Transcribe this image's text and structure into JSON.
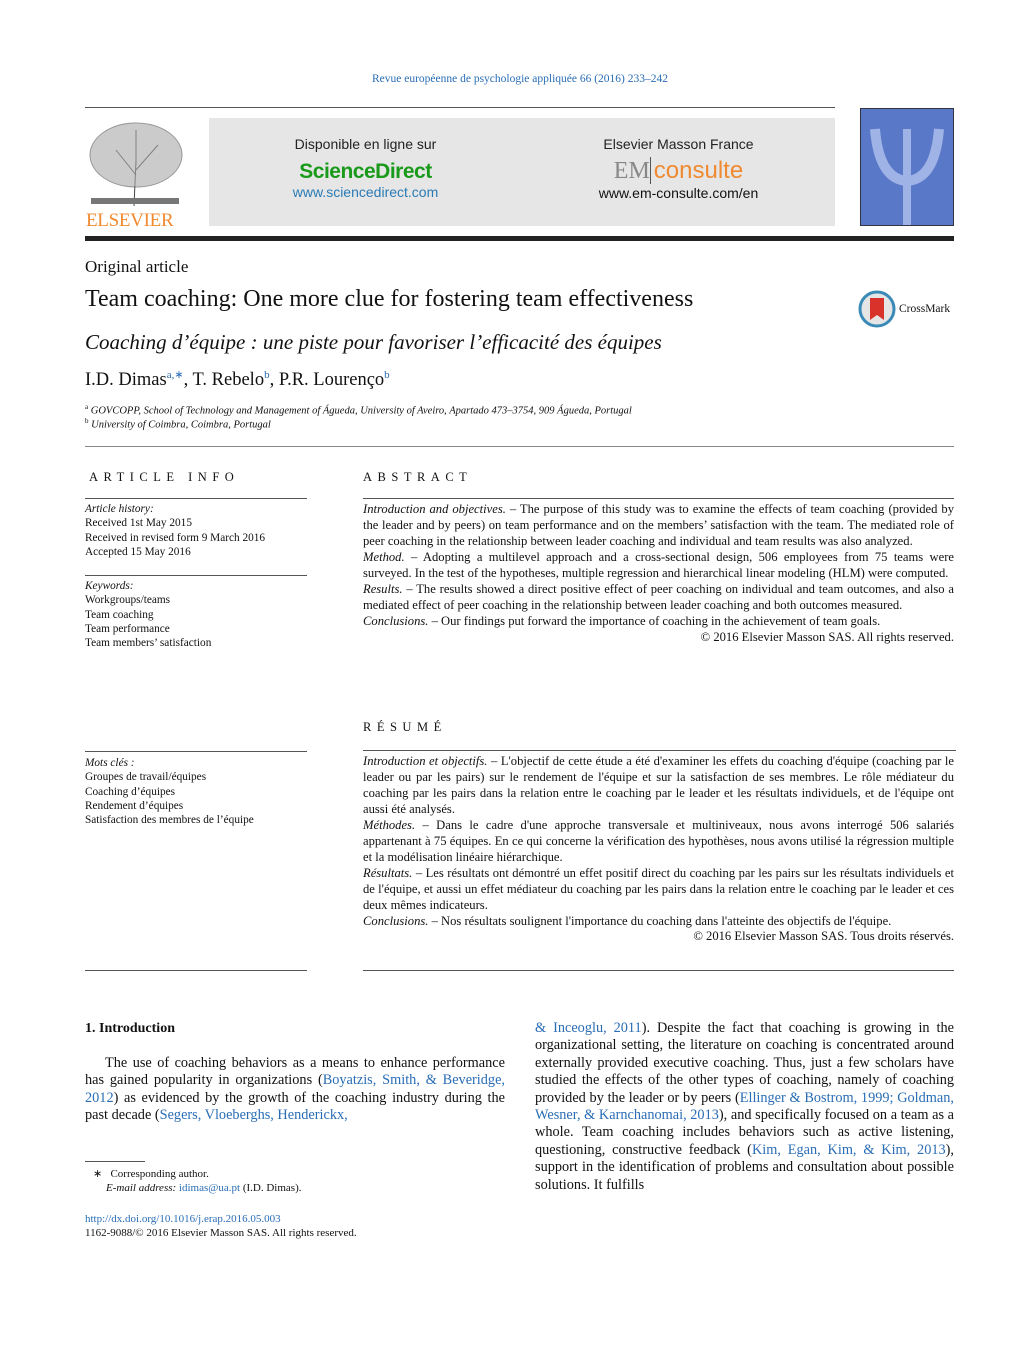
{
  "journal": "Revue européenne de psychologie appliquée 66 (2016) 233–242",
  "banner": {
    "left_title": "Disponible en ligne sur",
    "sciencedirect": "ScienceDirect",
    "sd_url": "www.sciencedirect.com",
    "right_title": "Elsevier Masson France",
    "em": "EM",
    "consulte": "consulte",
    "em_url": "www.em-consulte.com/en"
  },
  "publisher_logo": "ELSEVIER",
  "crossmark": "CrossMark",
  "article_type": "Original article",
  "title": "Team coaching: One more clue for fostering team effectiveness",
  "french_title": "Coaching d’équipe : une piste pour favoriser l’efficacité des équipes",
  "authors": [
    {
      "name": "I.D. Dimas",
      "sup": "a,∗"
    },
    {
      "name": "T. Rebelo",
      "sup": "b"
    },
    {
      "name": "P.R. Lourenço",
      "sup": "b"
    }
  ],
  "affiliations": [
    {
      "sup": "a",
      "text": "GOVCOPP, School of Technology and Management of Águeda, University of Aveiro, Apartado 473–3754, 909 Águeda, Portugal"
    },
    {
      "sup": "b",
      "text": "University of Coimbra, Coimbra, Portugal"
    }
  ],
  "article_info": {
    "heading": "ARTICLE INFO",
    "history_label": "Article history:",
    "history": [
      "Received 1st May 2015",
      "Received in revised form 9 March 2016",
      "Accepted 15 May 2016"
    ],
    "keywords_label": "Keywords:",
    "keywords": [
      "Workgroups/teams",
      "Team coaching",
      "Team performance",
      "Team members’ satisfaction"
    ],
    "mots_label": "Mots clés :",
    "mots": [
      "Groupes de travail/équipes",
      "Coaching d’équipes",
      "Rendement d’équipes",
      "Satisfaction des membres de l’équipe"
    ]
  },
  "abstract": {
    "heading": "ABSTRACT",
    "paragraphs": [
      {
        "label": "Introduction and objectives.",
        "text": " – The purpose of this study was to examine the effects of team coaching (provided by the leader and by peers) on team performance and on the members’ satisfaction with the team. The mediated role of peer coaching in the relationship between leader coaching and individual and team results was also analyzed."
      },
      {
        "label": "Method.",
        "text": " – Adopting a multilevel approach and a cross-sectional design, 506 employees from 75 teams were surveyed. In the test of the hypotheses, multiple regression and hierarchical linear modeling (HLM) were computed."
      },
      {
        "label": "Results.",
        "text": " – The results showed a direct positive effect of peer coaching on individual and team outcomes, and also a mediated effect of peer coaching in the relationship between leader coaching and both outcomes measured."
      },
      {
        "label": "Conclusions.",
        "text": " – Our findings put forward the importance of coaching in the achievement of team goals."
      }
    ],
    "copyright": "© 2016 Elsevier Masson SAS. All rights reserved."
  },
  "resume": {
    "heading": "RÉSUMÉ",
    "paragraphs": [
      {
        "label": "Introduction et objectifs.",
        "text": " – L'objectif de cette étude a été d'examiner les effets du coaching d'équipe (coaching par le leader ou par les pairs) sur le rendement de l'équipe et sur la satisfaction de ses membres. Le rôle médiateur du coaching par les pairs dans la relation entre le coaching par le leader et les résultats individuels, et de l'équipe ont aussi été analysés."
      },
      {
        "label": "Méthodes.",
        "text": " – Dans le cadre d'une approche transversale et multiniveaux, nous avons interrogé 506 salariés appartenant à 75 équipes. En ce qui concerne la vérification des hypothèses, nous avons utilisé la régression multiple et la modélisation linéaire hiérarchique."
      },
      {
        "label": "Résultats.",
        "text": " – Les résultats ont démontré un effet positif direct du coaching par les pairs sur les résultats individuels et de l'équipe, et aussi un effet médiateur du coaching par les pairs dans la relation entre le coaching par le leader et ces deux mêmes indicateurs."
      },
      {
        "label": "Conclusions.",
        "text": " – Nos résultats soulignent l'importance du coaching dans l'atteinte des objectifs de l'équipe."
      }
    ],
    "copyright": "© 2016 Elsevier Masson SAS. Tous droits réservés."
  },
  "intro": {
    "heading": "1.  Introduction",
    "col1": [
      {
        "t": "The use of coaching behaviors as a means to enhance performance has gained popularity in organizations ("
      },
      {
        "t": "Boyatzis, Smith, & Beveridge, 2012",
        "link": true
      },
      {
        "t": ") as evidenced by the growth of the coaching industry during the past decade ("
      },
      {
        "t": "Segers, Vloeberghs, Henderickx,",
        "link": true
      }
    ],
    "col2": [
      {
        "t": "& Inceoglu, 2011",
        "link": true
      },
      {
        "t": "). Despite the fact that coaching is growing in the organizational setting, the literature on coaching is concentrated around externally provided executive coaching. Thus, just a few scholars have studied the effects of the other types of coaching, namely of coaching provided by the leader or by peers ("
      },
      {
        "t": "Ellinger & Bostrom, 1999; Goldman, Wesner, & Karnchanomai, 2013",
        "link": true
      },
      {
        "t": "), and specifically focused on a team as a whole. Team coaching includes behaviors such as active listening, questioning, constructive feedback ("
      },
      {
        "t": "Kim, Egan, Kim, & Kim, 2013",
        "link": true
      },
      {
        "t": "), support in the identification of problems and consultation about possible solutions. It fulfills"
      }
    ]
  },
  "footnote": {
    "star": "∗",
    "corresponding": "Corresponding author.",
    "email_label": "E-mail address:",
    "email": "idimas@ua.pt",
    "email_suffix": " (I.D. Dimas)."
  },
  "doi": "http://dx.doi.org/10.1016/j.erap.2016.05.003",
  "issn": "1162-9088/© 2016 Elsevier Masson SAS. All rights reserved."
}
